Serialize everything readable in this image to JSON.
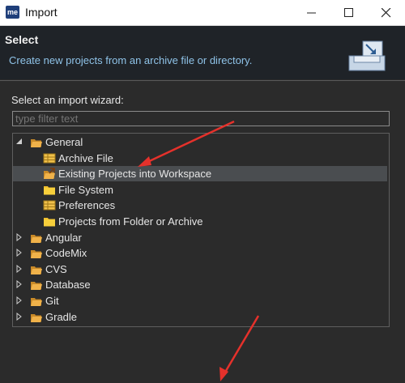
{
  "window": {
    "app_icon_text": "me",
    "title": "Import"
  },
  "header": {
    "title": "Select",
    "description": "Create new projects from an archive file or directory."
  },
  "body": {
    "label": "Select an import wizard:",
    "filter_placeholder": "type filter text"
  },
  "tree": {
    "items": [
      {
        "label": "General",
        "icon": "folder-open-icon",
        "expanded": true,
        "level": 0
      },
      {
        "label": "Archive File",
        "icon": "archive-icon",
        "level": 1
      },
      {
        "label": "Existing Projects into Workspace",
        "icon": "project-import-icon",
        "level": 1,
        "selected": true
      },
      {
        "label": "File System",
        "icon": "folder-icon",
        "level": 1
      },
      {
        "label": "Preferences",
        "icon": "preferences-icon",
        "level": 1
      },
      {
        "label": "Projects from Folder or Archive",
        "icon": "folder-icon",
        "level": 1
      },
      {
        "label": "Angular",
        "icon": "folder-open-icon",
        "expanded": false,
        "level": 0
      },
      {
        "label": "CodeMix",
        "icon": "folder-open-icon",
        "expanded": false,
        "level": 0
      },
      {
        "label": "CVS",
        "icon": "folder-open-icon",
        "expanded": false,
        "level": 0
      },
      {
        "label": "Database",
        "icon": "folder-open-icon",
        "expanded": false,
        "level": 0
      },
      {
        "label": "Git",
        "icon": "folder-open-icon",
        "expanded": false,
        "level": 0
      },
      {
        "label": "Gradle",
        "icon": "folder-open-icon",
        "expanded": false,
        "level": 0
      }
    ]
  },
  "colors": {
    "background": "#2b2b2b",
    "header_bg": "#1f2328",
    "description": "#8fc3e8",
    "selection": "#4a4d50",
    "folder": "#e8a33d",
    "annotation_arrow": "#e5312b"
  }
}
